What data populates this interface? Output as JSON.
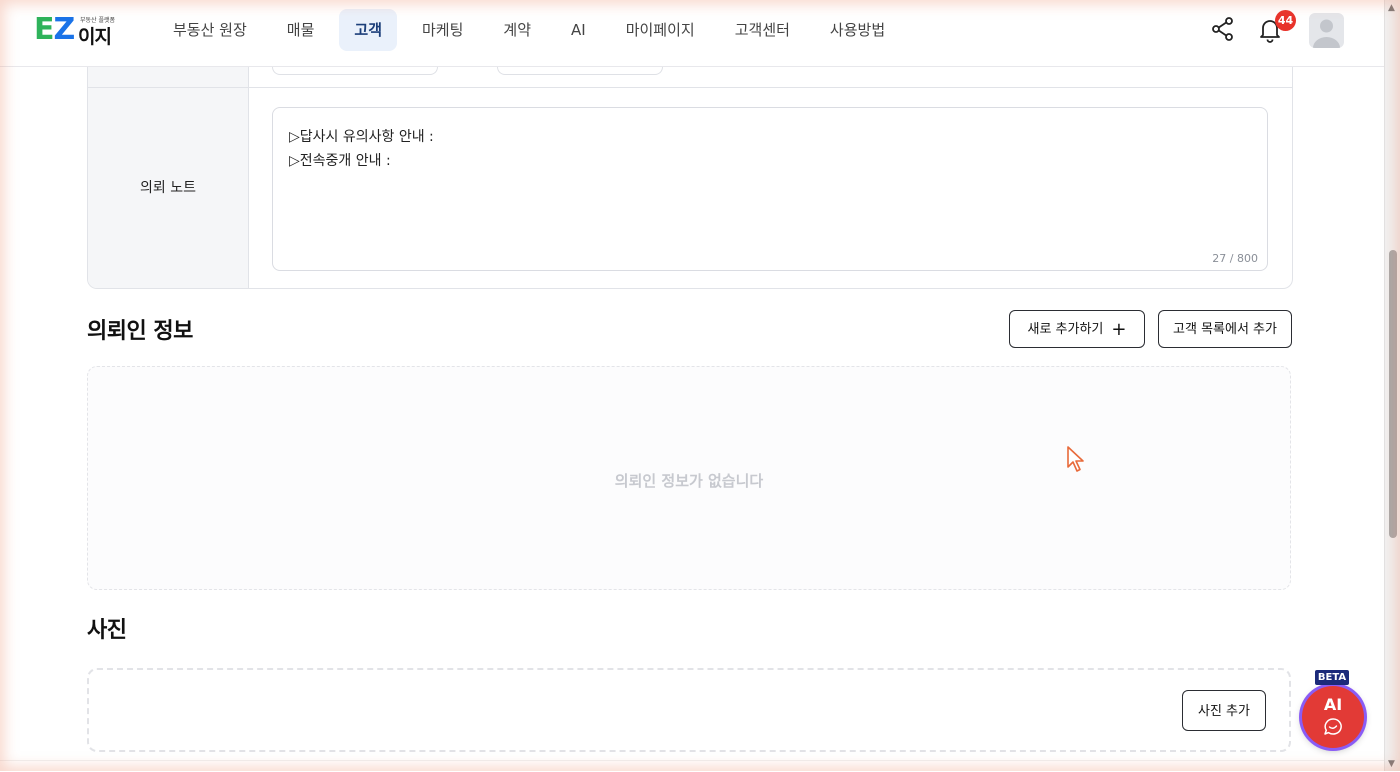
{
  "header": {
    "logo": {
      "text_e": "E",
      "text_z": "Z",
      "text_korean": "이지",
      "tagline": "부동산 플랫폼"
    },
    "nav": [
      {
        "label": "부동산 원장",
        "active": false
      },
      {
        "label": "매물",
        "active": false
      },
      {
        "label": "고객",
        "active": true
      },
      {
        "label": "마케팅",
        "active": false
      },
      {
        "label": "계약",
        "active": false
      },
      {
        "label": "AI",
        "active": false
      },
      {
        "label": "마이페이지",
        "active": false
      },
      {
        "label": "고객센터",
        "active": false
      },
      {
        "label": "사용방법",
        "active": false
      }
    ],
    "icons": {
      "share": "share-icon",
      "notifications": "bell-icon",
      "avatar": "user-avatar-icon"
    },
    "notification_count": "44"
  },
  "note": {
    "label": "의뢰 노트",
    "lines": [
      "▷답사시 유의사항 안내 :",
      "▷전속중개 안내 :"
    ],
    "char_count": "27 / 800"
  },
  "requester": {
    "title": "의뢰인 정보",
    "add_new_label": "새로 추가하기",
    "add_from_list_label": "고객 목록에서 추가",
    "empty_text": "의뢰인 정보가 없습니다"
  },
  "photos": {
    "title": "사진",
    "add_label": "사진 추가"
  },
  "ai_assistant": {
    "badge": "BETA",
    "label": "AI"
  },
  "colors": {
    "active_nav_bg": "#eaf1fb",
    "badge_red": "#e8332b",
    "ai_red": "#e23a36",
    "ai_ring": "#8a5cf5",
    "logo_green": "#2fb35b",
    "logo_blue": "#1a73e8"
  }
}
